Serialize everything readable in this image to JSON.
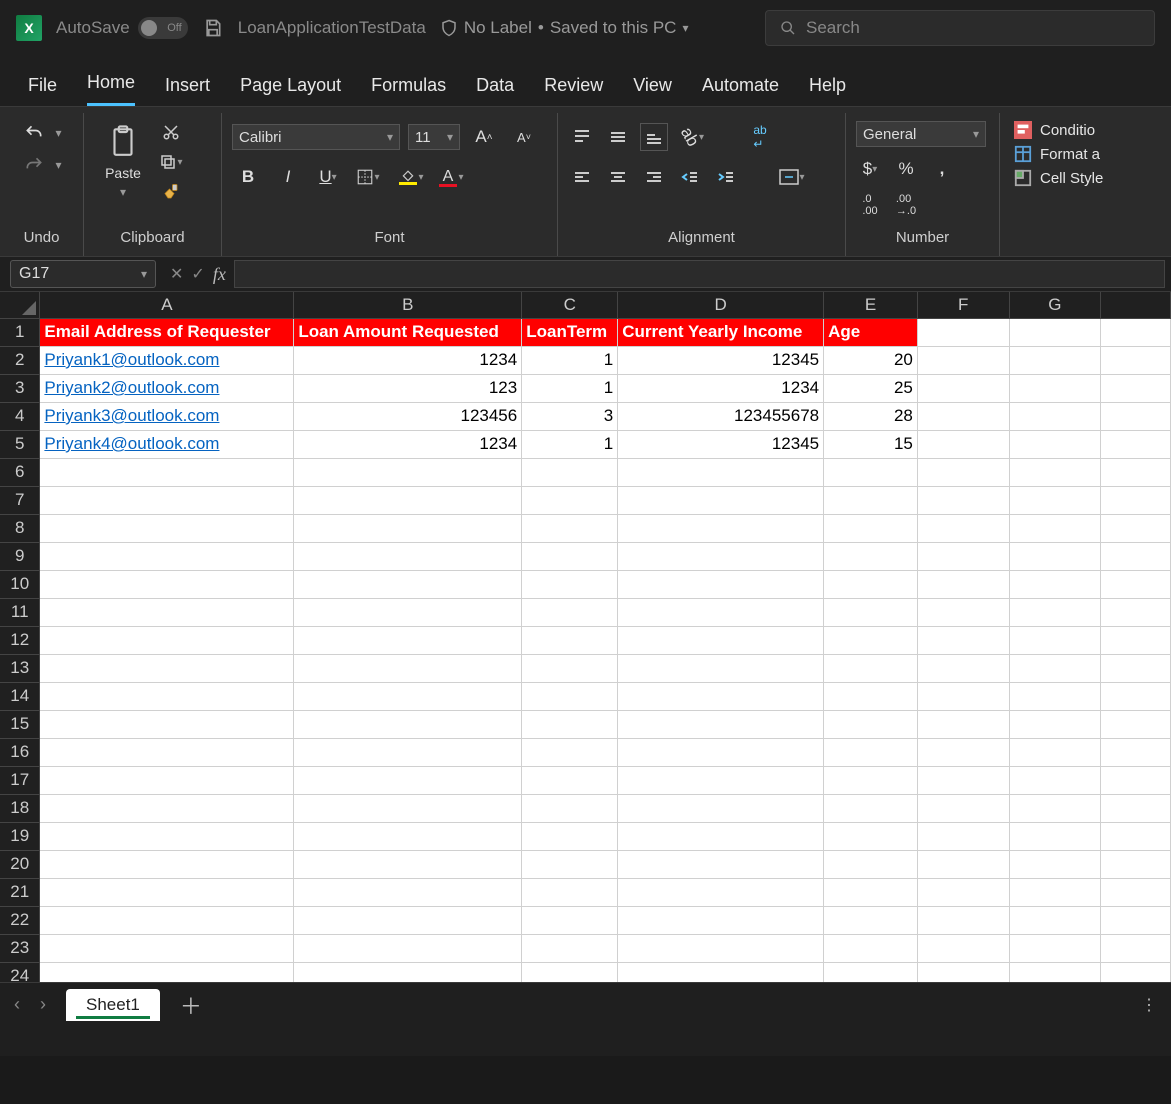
{
  "titlebar": {
    "autosave_label": "AutoSave",
    "autosave_state": "Off",
    "doc_name": "LoanApplicationTestData",
    "sensitivity": "No Label",
    "save_state": "Saved to this PC",
    "search_placeholder": "Search"
  },
  "tabs": [
    "File",
    "Home",
    "Insert",
    "Page Layout",
    "Formulas",
    "Data",
    "Review",
    "View",
    "Automate",
    "Help"
  ],
  "active_tab": "Home",
  "ribbon": {
    "undo_label": "Undo",
    "clipboard_label": "Clipboard",
    "paste_label": "Paste",
    "font_label": "Font",
    "font_name": "Calibri",
    "font_size": "11",
    "alignment_label": "Alignment",
    "number_label": "Number",
    "number_format": "General",
    "styles": {
      "conditional": "Conditio",
      "format_as": "Format a",
      "cell_styles": "Cell Style"
    }
  },
  "namebox": "G17",
  "formula": "",
  "columns": [
    "A",
    "B",
    "C",
    "D",
    "E",
    "F",
    "G"
  ],
  "col_widths": [
    "cA",
    "cB",
    "cC",
    "cD",
    "cE",
    "cF",
    "cG",
    "cH"
  ],
  "row_count": 24,
  "headers": [
    "Email Address of Requester",
    "Loan Amount Requested",
    "LoanTerm",
    "Current Yearly Income",
    "Age"
  ],
  "rows": [
    {
      "email": "Priyank1@outlook.com",
      "loan": "1234",
      "term": "1",
      "income": "12345",
      "age": "20"
    },
    {
      "email": "Priyank2@outlook.com",
      "loan": "123",
      "term": "1",
      "income": "1234",
      "age": "25"
    },
    {
      "email": "Priyank3@outlook.com",
      "loan": "123456",
      "term": "3",
      "income": "123455678",
      "age": "28"
    },
    {
      "email": "Priyank4@outlook.com",
      "loan": "1234",
      "term": "1",
      "income": "12345",
      "age": "15"
    }
  ],
  "sheet_tab": "Sheet1",
  "chart_data": {
    "type": "table",
    "title": "LoanApplicationTestData",
    "columns": [
      "Email Address of Requester",
      "Loan Amount Requested",
      "LoanTerm",
      "Current Yearly Income",
      "Age"
    ],
    "rows": [
      [
        "Priyank1@outlook.com",
        1234,
        1,
        12345,
        20
      ],
      [
        "Priyank2@outlook.com",
        123,
        1,
        1234,
        25
      ],
      [
        "Priyank3@outlook.com",
        123456,
        3,
        123455678,
        28
      ],
      [
        "Priyank4@outlook.com",
        1234,
        1,
        12345,
        15
      ]
    ]
  }
}
